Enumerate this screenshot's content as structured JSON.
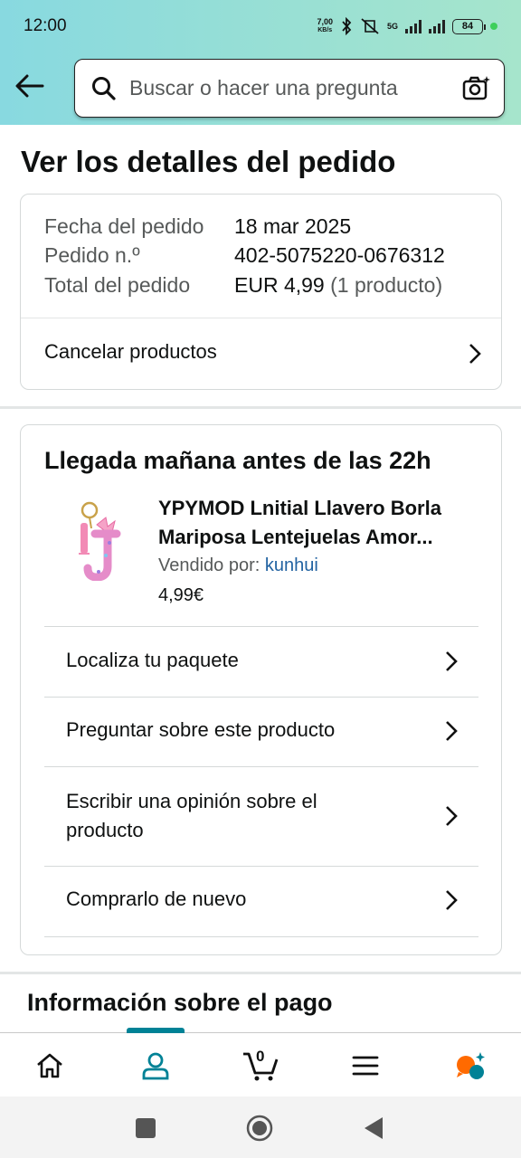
{
  "status_bar": {
    "time": "12:00",
    "net_speed_value": "7,00",
    "net_speed_unit": "KB/s",
    "network": "5G",
    "battery": "84"
  },
  "search": {
    "placeholder": "Buscar o hacer una pregunta"
  },
  "page_title": "Ver los detalles del pedido",
  "order_summary": {
    "date_label": "Fecha del pedido",
    "date_value": "18 mar 2025",
    "number_label": "Pedido n.º",
    "number_value": "402-5075220-0676312",
    "total_label": "Total del pedido",
    "total_value": "EUR 4,99",
    "total_items": "(1 producto)",
    "cancel_label": "Cancelar productos"
  },
  "shipment": {
    "arrival": "Llegada mañana antes de las 22h",
    "product_title": "YPYMOD Lnitial Llavero Borla Mariposa Lentejuelas Amor...",
    "sold_by_label": "Vendido por:",
    "seller": "kunhui",
    "price": "4,99€",
    "actions": [
      {
        "label": "Localiza tu paquete"
      },
      {
        "label": "Preguntar sobre este producto"
      },
      {
        "label": "Escribir una opinión sobre el producto"
      },
      {
        "label": "Comprarlo de nuevo"
      }
    ]
  },
  "payment_title": "Información sobre el pago",
  "bottom_nav": {
    "cart_count": "0",
    "active": "account",
    "accent_color": "#008296"
  },
  "colors": {
    "link": "#2162a1",
    "header_gradient_start": "#88d9e0",
    "header_gradient_end": "#a6e5cc"
  }
}
